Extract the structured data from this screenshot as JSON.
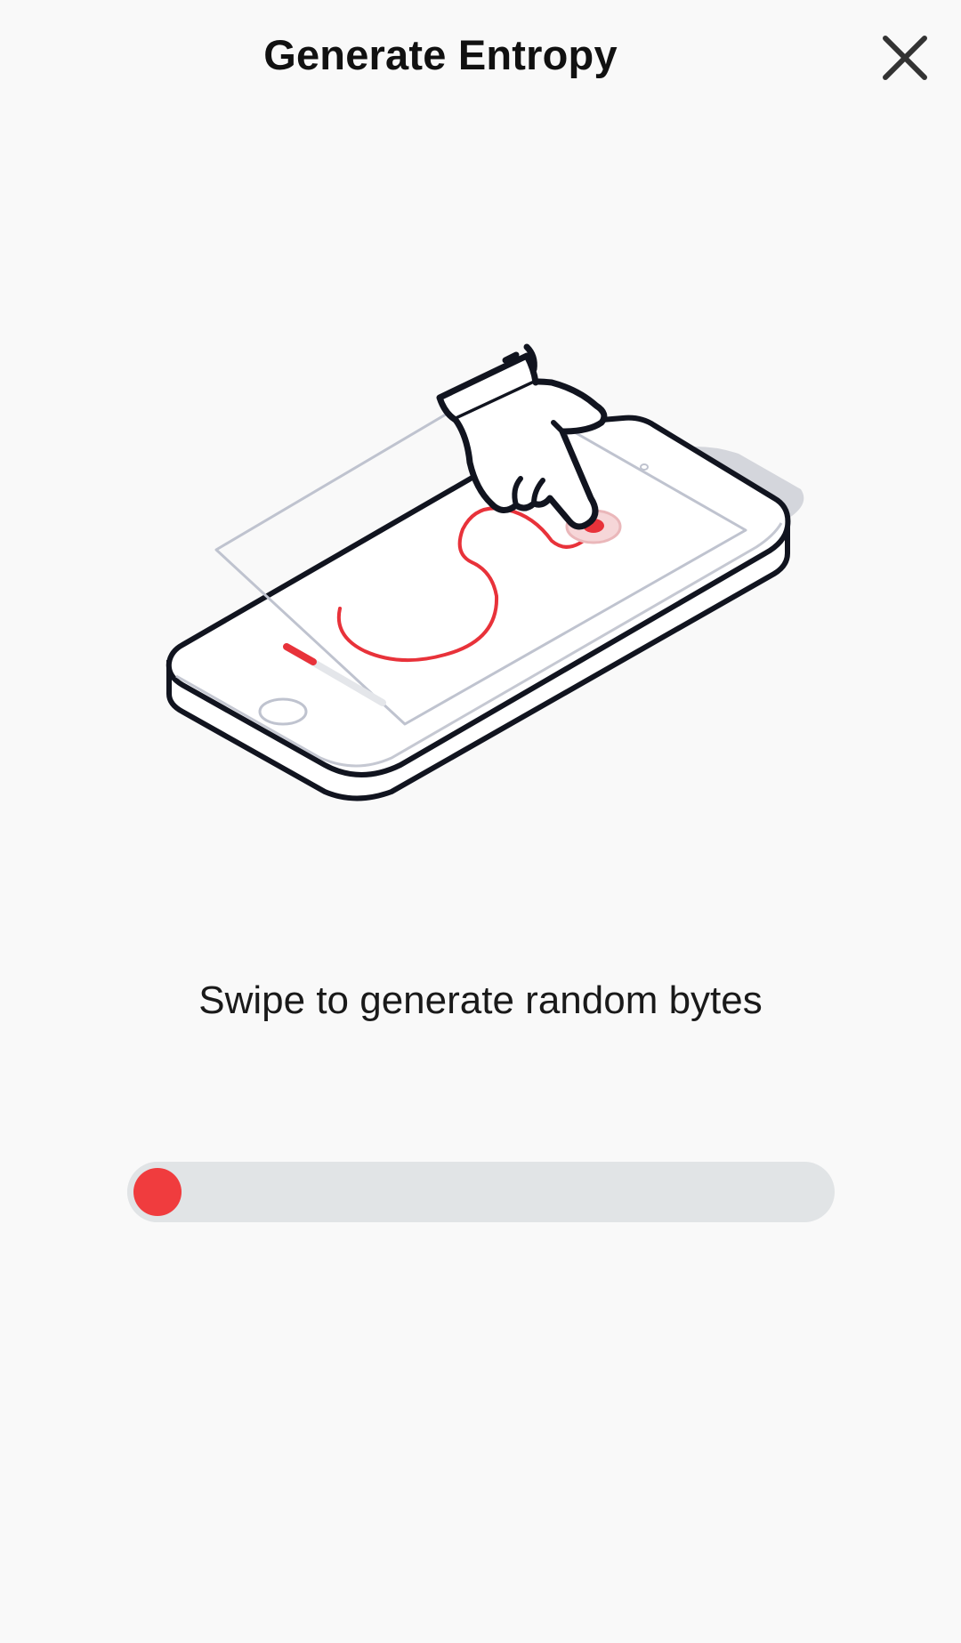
{
  "header": {
    "title": "Generate Entropy",
    "close_icon": "close-icon"
  },
  "illustration": {
    "icon": "phone-swipe-illustration",
    "accent_color": "#e8323a"
  },
  "instruction": {
    "text": "Swipe to generate random bytes"
  },
  "progress": {
    "value_percent": 0,
    "indicator_color": "#f03c3e",
    "track_color": "#e1e4e6"
  }
}
